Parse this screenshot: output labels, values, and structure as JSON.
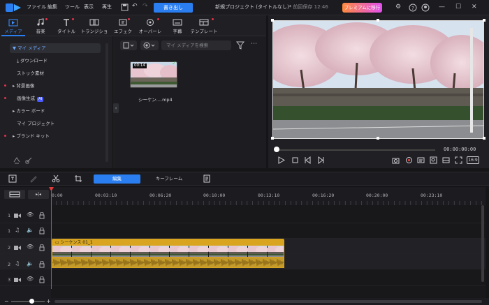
{
  "titlebar": {
    "menus": [
      "ファイル",
      "編集",
      "ツール",
      "表示",
      "再生"
    ],
    "export_label": "書き出し",
    "project_title": "新規プロジェクト (タイトルなし)*",
    "save_status": "前回保存 12:46",
    "premium_label": "プレミアムに移行"
  },
  "toolstrip": {
    "tools": [
      {
        "label": "メディア",
        "icon": "media-icon"
      },
      {
        "label": "音楽",
        "icon": "music-icon"
      },
      {
        "label": "タイトル",
        "icon": "title-icon"
      },
      {
        "label": "トランジション",
        "icon": "transition-icon"
      },
      {
        "label": "エフェクト",
        "icon": "effect-icon"
      },
      {
        "label": "オーバーレイ",
        "icon": "overlay-icon"
      },
      {
        "label": "字幕",
        "icon": "subtitle-icon"
      },
      {
        "label": "テンプレート",
        "icon": "template-icon"
      }
    ]
  },
  "sidebar": {
    "items": [
      {
        "label": "▼ マイ メディア"
      },
      {
        "label": "⤓ ダウンロード"
      },
      {
        "label": "ストック素材"
      },
      {
        "label": "▸ 背景画像"
      },
      {
        "label": "画像生成",
        "badge": "AI"
      },
      {
        "label": "▸ カラー ボード"
      },
      {
        "label": "マイ プロジェクト"
      },
      {
        "label": "▸ ブランド キット"
      }
    ]
  },
  "media": {
    "search_placeholder": "マイ メディアを検索",
    "clip_duration": "00:14",
    "clip_name": "シーケン....mp4"
  },
  "preview": {
    "timecode": "00:00:00:00",
    "aspect": "16:9"
  },
  "timeline": {
    "edit_tab": "編集",
    "keyframe_tab": "キーフレーム",
    "ruler": [
      "0:00",
      "00:03:10",
      "00:06:20",
      "00:10:00",
      "00:13:10",
      "00:16:20",
      "00:20:00",
      "00:23:10"
    ],
    "clip_label": "シーケンス 01_1",
    "tracks": [
      "1",
      "1",
      "2",
      "2",
      "3"
    ]
  },
  "colors": {
    "accent": "#2a7ef0",
    "clip": "#d9a521",
    "playhead": "#e23b3b"
  }
}
